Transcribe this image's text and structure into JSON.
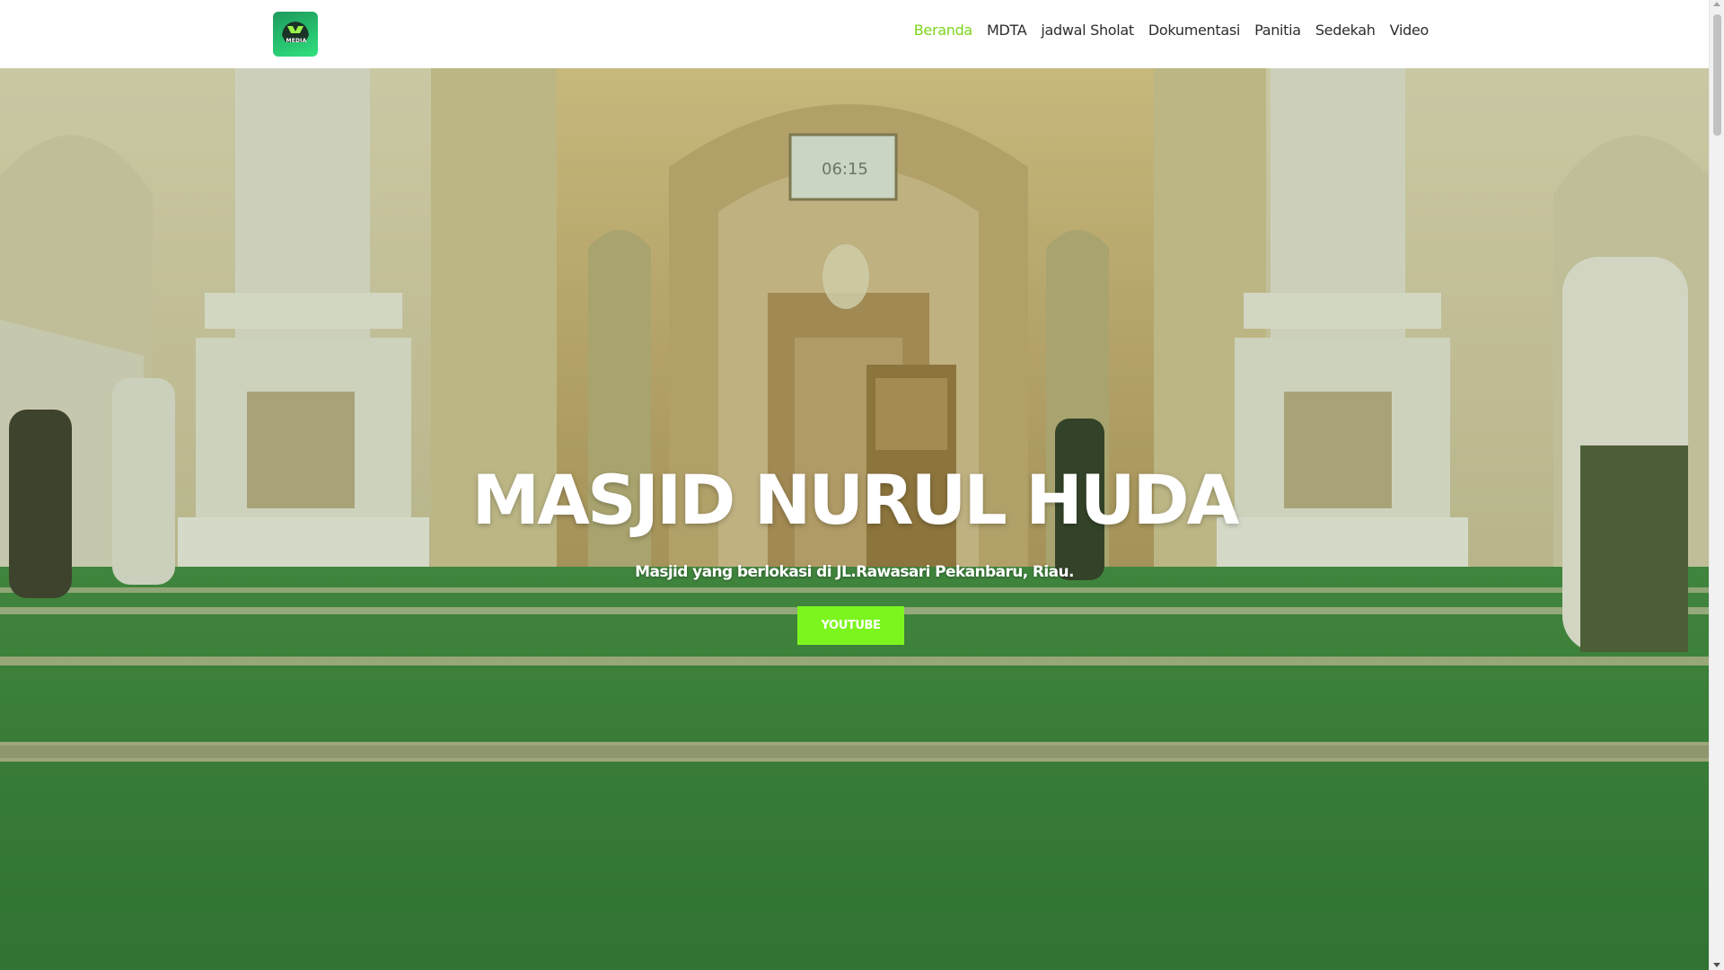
{
  "header": {
    "logo": {
      "icon": "media-logo-icon",
      "text": "MEDIA"
    },
    "nav": [
      {
        "label": "Beranda",
        "active": true
      },
      {
        "label": "MDTA",
        "active": false
      },
      {
        "label": "jadwal Sholat",
        "active": false
      },
      {
        "label": "Dokumentasi",
        "active": false
      },
      {
        "label": "Panitia",
        "active": false
      },
      {
        "label": "Sedekah",
        "active": false
      },
      {
        "label": "Video",
        "active": false
      }
    ]
  },
  "hero": {
    "title": "MASJID NURUL HUDA",
    "subtitle": "Masjid yang berlokasi di JL.Rawasari Pekanbaru, Riau.",
    "button_label": "YOUTUBE",
    "background_image": "mosque-interior-image",
    "clock_display": "06:15"
  },
  "colors": {
    "accent": "#7dd61c",
    "button": "#7cf51f",
    "carpet": "#2f7d3a",
    "nav_text": "#2d2d2d"
  }
}
